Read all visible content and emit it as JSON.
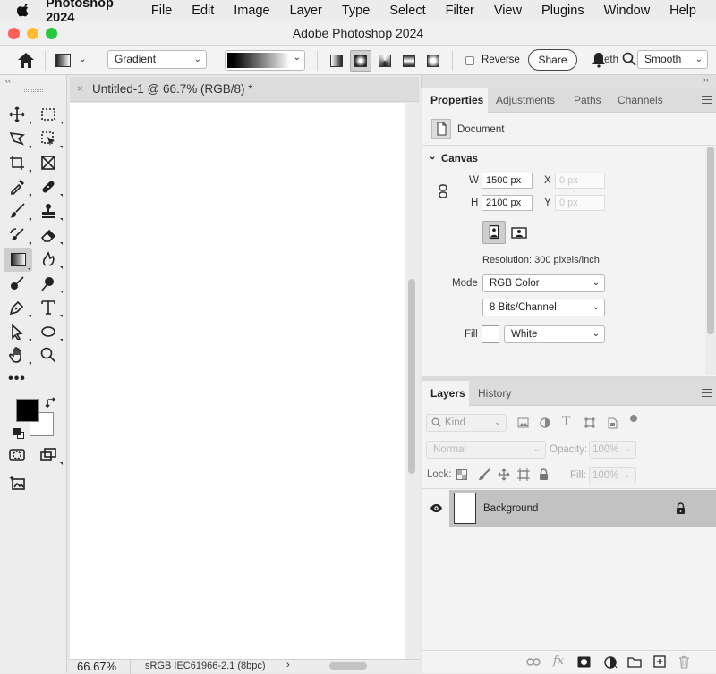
{
  "menubar": {
    "app_name": "Photoshop 2024",
    "items": [
      "File",
      "Edit",
      "Image",
      "Layer",
      "Type",
      "Select",
      "Filter",
      "View",
      "Plugins",
      "Window",
      "Help"
    ]
  },
  "window": {
    "title": "Adobe Photoshop 2024"
  },
  "options": {
    "gradient_mode": "Gradient",
    "reverse_label": "Reverse",
    "share_label": "Share",
    "method_partial": "eth",
    "method": "Smooth"
  },
  "document": {
    "tab_title": "Untitled-1 @ 66.7% (RGB/8) *",
    "zoom": "66.67%",
    "profile": "sRGB IEC61966-2.1 (8bpc)"
  },
  "properties": {
    "tabs": [
      "Properties",
      "Adjustments",
      "Paths",
      "Channels"
    ],
    "section_label": "Document",
    "canvas_header": "Canvas",
    "w_label": "W",
    "w_value": "1500 px",
    "h_label": "H",
    "h_value": "2100 px",
    "x_label": "X",
    "x_value": "0 px",
    "y_label": "Y",
    "y_value": "0 px",
    "resolution": "Resolution: 300 pixels/inch",
    "mode_label": "Mode",
    "mode_value": "RGB Color",
    "bits_value": "8 Bits/Channel",
    "fill_label": "Fill",
    "fill_value": "White"
  },
  "layers": {
    "tabs": [
      "Layers",
      "History"
    ],
    "filter_kind": "Kind",
    "blend_mode": "Normal",
    "opacity_label": "Opacity:",
    "opacity_value": "100%",
    "lock_label": "Lock:",
    "fill_label": "Fill:",
    "fill_value": "100%",
    "layer_name": "Background"
  },
  "colors": {
    "foreground": "#000000",
    "background": "#ffffff",
    "traffic_red": "#ff5f57",
    "traffic_yellow": "#febc2e",
    "traffic_green": "#28c840"
  }
}
